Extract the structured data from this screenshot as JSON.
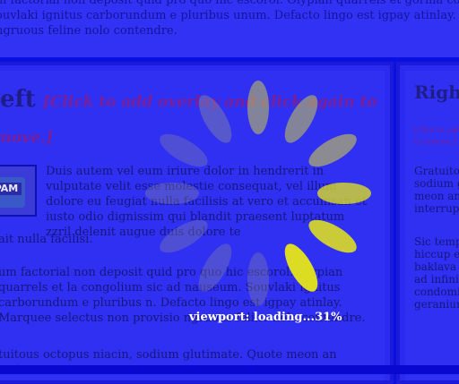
{
  "top_strip": {
    "lines": [
      "m factorial non deposit quid pro quo hic escorol. Olypian quarrels et gorilla congolium sic",
      "ouvlaki ignitus carborundum e pluribus unum. Defacto lingo est igpay atinlay. Marquee selecti",
      "ngruous feline nolo contendre."
    ]
  },
  "main": {
    "title": "eft",
    "overlay_hint": "[Click to add overlay and click again to",
    "overlay_hint_2": "move.]",
    "image_label": "SPAM",
    "paragraph_1": "Duis autem vel eum iriure dolor in hendrerit in vulputate velit esse molestie consequat, vel illum dolore eu feugiat nulla facilisis at vero et accumsan et iusto odio dignissim qui blandit praesent luptatum zzril delenit augue duis dolore te",
    "paragraph_1b": "ait nulla facilisi.",
    "paragraph_2": "um factorial non deposit quid pro quo hic escorol. Olypian quarrels et la congolium sic ad nauseum. Souvlaki ignitus carborundum e pluribus n. Defacto lingo est igpay atinlay. Marquee selectus non provisio ngruous feline nolo contendre.",
    "paragraph_3": "tuitous octopus niacin, sodium glutimate. Quote meon an estimate et"
  },
  "sidebar": {
    "title": "Right",
    "hint_lines": [
      "[Click to add",
      "to remove.]"
    ],
    "text_1": [
      "Gratuitou",
      "sodium gl",
      "meon an e",
      "interruptu"
    ],
    "text_2": [
      "Sic tempu",
      "hiccup es",
      "baklava e",
      "ad infinitu",
      "condomin",
      "geranium"
    ]
  },
  "loading": {
    "status": "viewport: loading...31%",
    "progress_percent": 31,
    "active_color": "#e6e619",
    "inactive_color": "#8a8aa0"
  }
}
